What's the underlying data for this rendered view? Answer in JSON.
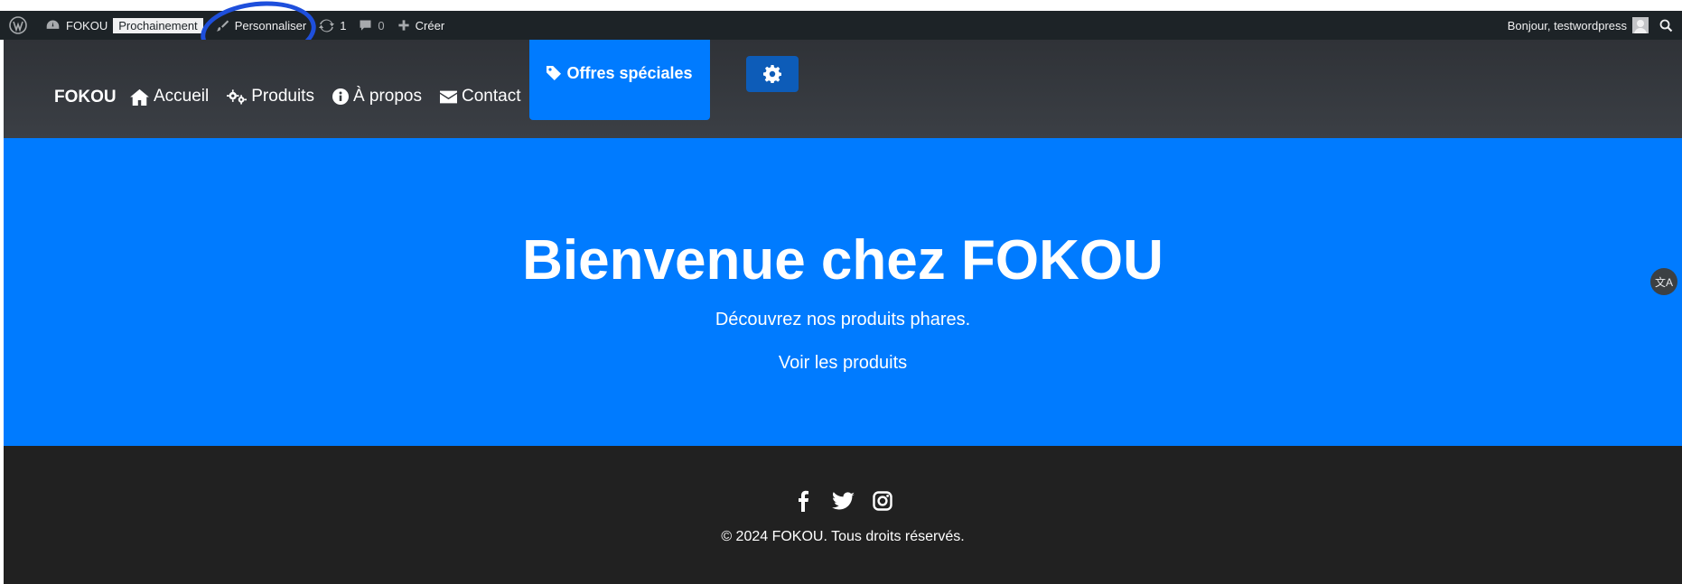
{
  "adminbar": {
    "site_name": "FOKOU",
    "status_badge": "Prochainement",
    "customize_label": "Personnaliser",
    "updates_count": "1",
    "comments_count": "0",
    "create_label": "Créer",
    "greeting": "Bonjour, testwordpress"
  },
  "nav": {
    "brand": "FOKOU",
    "items": [
      {
        "label": "Accueil",
        "icon": "home-icon"
      },
      {
        "label": "Produits",
        "icon": "cogs-icon"
      },
      {
        "label": "À propos",
        "icon": "info-icon"
      },
      {
        "label": "Contact",
        "icon": "envelope-icon"
      }
    ],
    "special_offers": "Offres spéciales"
  },
  "hero": {
    "title": "Bienvenue chez FOKOU",
    "subtitle": "Découvrez nos produits phares.",
    "cta": "Voir les produits"
  },
  "footer": {
    "copyright": "© 2024 FOKOU. Tous droits réservés."
  },
  "colors": {
    "adminbar": "#1d2327",
    "navbar": "#343a40",
    "accent": "#007bff",
    "footer": "#212121",
    "annotation_circle": "#1e4fdc"
  }
}
